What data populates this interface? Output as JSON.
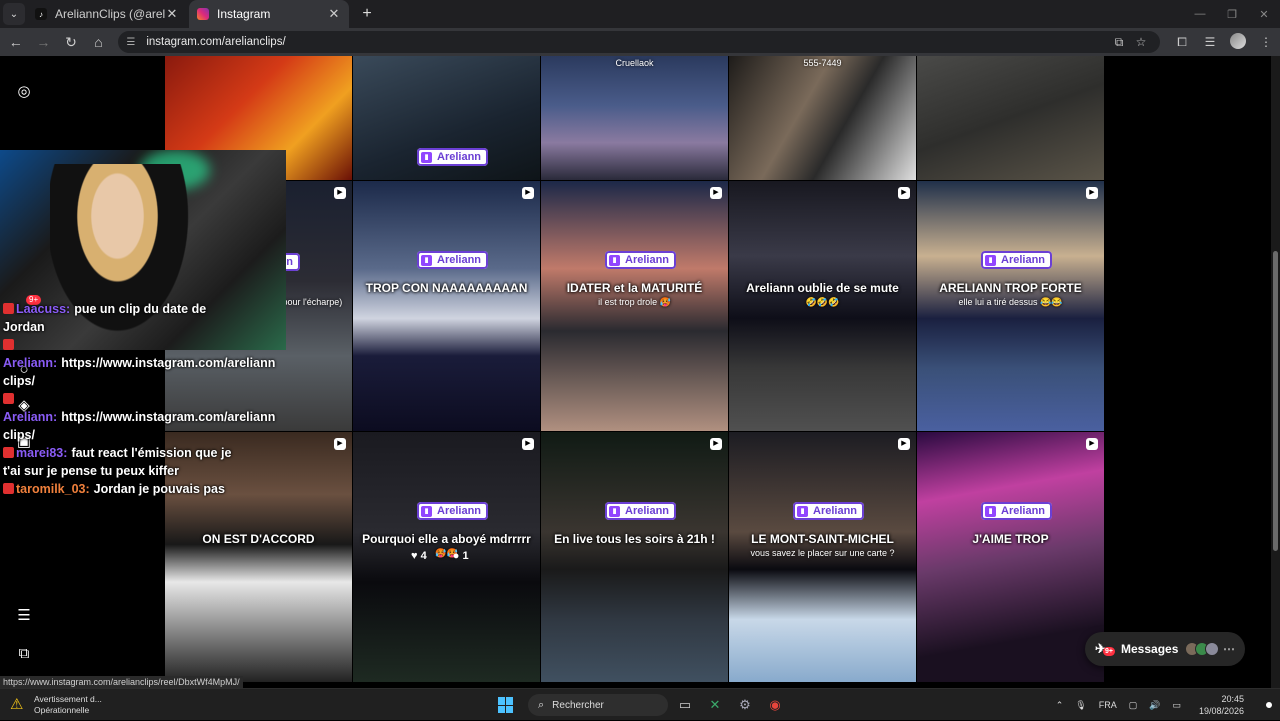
{
  "browser": {
    "tabs": [
      {
        "title": "AreliannClips (@arelianclips) |",
        "favicon": "tiktok-icon",
        "active": false
      },
      {
        "title": "Instagram",
        "favicon": "instagram-icon",
        "active": true
      }
    ],
    "url": "instagram.com/arelianclips/",
    "status_url": "https://www.instagram.com/arelianclips/reel/DbxtWf4MpMJ/"
  },
  "grid": {
    "badge_label": "Areliann",
    "posts": [
      {
        "caption": "",
        "sub": "",
        "badge": false,
        "reel": false
      },
      {
        "caption": "",
        "sub": "",
        "badge": true,
        "reel": false
      },
      {
        "caption": "",
        "sub": "Cruellaok",
        "badge": false,
        "reel": false
      },
      {
        "caption": "",
        "sub": "555-7449",
        "badge": false,
        "reel": false
      },
      {
        "caption": "",
        "sub": "",
        "badge": false,
        "reel": false
      },
      {
        "caption": "r DATE",
        "sub": "on rigole bien sur 😂 (sauf pour l'écharpe)",
        "badge": true,
        "reel": true
      },
      {
        "caption": "TROP CON NAAAAAAAAAN",
        "sub": "",
        "badge": true,
        "reel": true
      },
      {
        "caption": "IDATER et la MATURITÉ",
        "sub": "il est trop drole 🥵",
        "badge": true,
        "reel": true
      },
      {
        "caption": "Areliann oublie de se mute",
        "sub": "🤣🤣🤣",
        "badge": false,
        "reel": true
      },
      {
        "caption": "ARELIANN TROP FORTE",
        "sub": "elle lui a tiré dessus 😂😂",
        "badge": true,
        "reel": true
      },
      {
        "caption": "ON EST D'ACCORD",
        "sub": "",
        "badge": false,
        "reel": true
      },
      {
        "caption": "Pourquoi elle a aboyé mdrrrrr",
        "sub": "🥵🥵",
        "badge": true,
        "reel": true,
        "likes": "4",
        "comments": "1"
      },
      {
        "caption": "En live tous les soirs à 21h !",
        "sub": "",
        "badge": true,
        "reel": true
      },
      {
        "caption": "LE MONT-SAINT-MICHEL",
        "sub": "vous savez le placer sur une carte ?",
        "badge": true,
        "reel": true
      },
      {
        "caption": "J'AIME TROP",
        "sub": "",
        "badge": true,
        "reel": true
      }
    ]
  },
  "chat": {
    "notif_count": "9+",
    "messages": [
      {
        "user": "Laacuss:",
        "user_color": "#8a5cf6",
        "text": "pue un clip du date de Jordan"
      },
      {
        "user": "Areliann:",
        "user_color": "#8a5cf6",
        "text": "https://www.instagram.com/areliann clips/"
      },
      {
        "user": "Areliann:",
        "user_color": "#8a5cf6",
        "text": "https://www.instagram.com/areliann clips/"
      },
      {
        "user": "marei83:",
        "user_color": "#8a5cf6",
        "text": "faut react l'émission que je t'ai sur je pense tu peux kiffer"
      },
      {
        "user": "taromilk_03:",
        "user_color": "#f0803c",
        "text": "Jordan je pouvais pas"
      }
    ]
  },
  "messages_pill": {
    "label": "Messages",
    "badge": "9+"
  },
  "taskbar": {
    "alert_title": "Avertissement d...",
    "alert_sub": "Opérationnelle",
    "search_placeholder": "Rechercher",
    "lang": "FRA",
    "time": "20:45",
    "date": "19/08/2026"
  }
}
